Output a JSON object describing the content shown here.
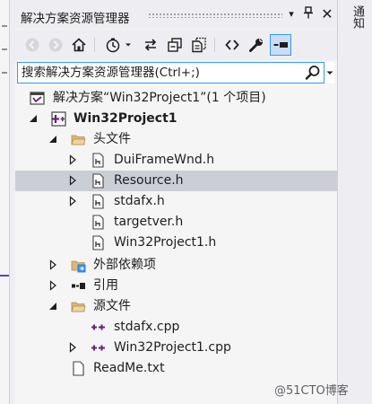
{
  "panel": {
    "title": "解决方案资源管理器",
    "pin_glyph": "📌",
    "close_glyph": "✕",
    "dropdown_glyph": "▾"
  },
  "right_tab": {
    "label": "通知"
  },
  "search": {
    "placeholder": "搜索解决方案资源管理器(Ctrl+;)"
  },
  "tree": {
    "solution": "解决方案“Win32Project1”(1 个项目)",
    "project": "Win32Project1",
    "header_folder": "头文件",
    "header_files": [
      "DuiFrameWnd.h",
      "Resource.h",
      "stdafx.h",
      "targetver.h",
      "Win32Project1.h"
    ],
    "external_deps": "外部依赖项",
    "references": "引用",
    "source_folder": "源文件",
    "source_files": [
      "stdafx.cpp",
      "Win32Project1.cpp"
    ],
    "readme": "ReadMe.txt",
    "selected_item": "Resource.h"
  },
  "watermark": "@51CTO博客",
  "colors": {
    "accent": "#3399ff",
    "selection": "#ccced6",
    "vs_purple": "#68217a",
    "folder": "#dcb67a"
  }
}
